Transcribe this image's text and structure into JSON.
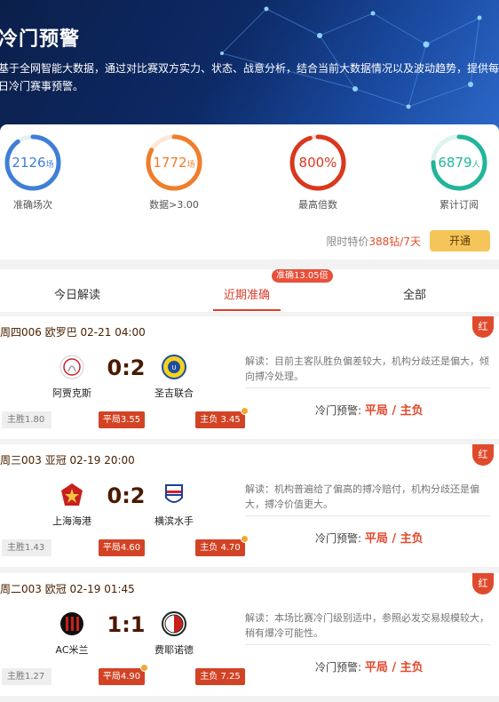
{
  "banner": {
    "title": "冷门预警",
    "description": "基于全网智能大数据，通过对比赛双方实力、状态、战意分析，结合当前大数据情况以及波动趋势，提供每日冷门赛事预警。"
  },
  "stats": [
    {
      "value": "2126",
      "unit": "场",
      "label": "准确场次",
      "color": "#3f7fd6",
      "fill": 0.9
    },
    {
      "value": "1772",
      "unit": "场",
      "label": "数据>3.00",
      "color": "#f07d2a",
      "fill": 0.83
    },
    {
      "value": "800%",
      "unit": "",
      "label": "最高倍数",
      "color": "#d9381e",
      "fill": 0.95
    },
    {
      "value": "6879",
      "unit": "人",
      "label": "累计订阅",
      "color": "#22b59a",
      "fill": 0.75
    }
  ],
  "promo": {
    "prefix": "限时特价",
    "price": "388钻/7天",
    "button": "开通"
  },
  "tabs": {
    "items": [
      "今日解读",
      "近期准确",
      "全部"
    ],
    "active": 1,
    "badge": "准确13.05倍"
  },
  "matches": [
    {
      "header": "周四006 欧罗巴 02-21 04:00",
      "flag": "红",
      "home": "阿贾克斯",
      "home_logo": "ajax-logo-icon",
      "away": "圣吉联合",
      "away_logo": "union-sg-logo-icon",
      "score": "0:2",
      "analysis": "解读：目前主客队胜负偏差较大，机构分歧还是偏大，倾向搏冷处理。",
      "alert_label": "冷门预警:",
      "alert_value": "平局 / 主负",
      "odd_home": "主胜1.80",
      "odd_draw": "平局3.55",
      "odd_away": "主负 3.45"
    },
    {
      "header": "周三003 亚冠 02-19 20:00",
      "flag": "红",
      "home": "上海海港",
      "home_logo": "shanghai-port-logo-icon",
      "away": "横滨水手",
      "away_logo": "yokohama-logo-icon",
      "score": "0:2",
      "analysis": "解读：机构普遍给了偏高的搏冷赔付，机构分歧还是偏大，搏冷价值更大。",
      "alert_label": "冷门预警:",
      "alert_value": "平局 / 主负",
      "odd_home": "主胜1.43",
      "odd_draw": "平局4.60",
      "odd_away": "主负 4.70"
    },
    {
      "header": "周二003 欧冠 02-19 01:45",
      "flag": "红",
      "home": "AC米兰",
      "home_logo": "ac-milan-logo-icon",
      "away": "费耶诺德",
      "away_logo": "feyenoord-logo-icon",
      "score": "1:1",
      "analysis": "解读：本场比赛冷门级别适中，参照必发交易规模较大，稍有爆冷可能性。",
      "alert_label": "冷门预警:",
      "alert_value": "平局 / 主负",
      "odd_home": "主胜1.27",
      "odd_draw": "平局4.90",
      "odd_away": "主负 7.25"
    }
  ]
}
